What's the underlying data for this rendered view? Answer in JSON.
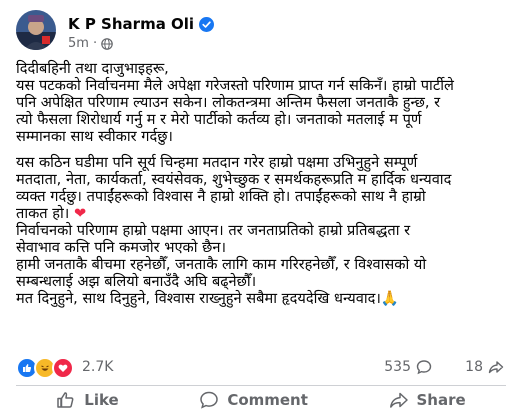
{
  "post": {
    "author": "K P Sharma Oli",
    "time": "5m",
    "separator": "·",
    "paragraph1": [
      "दिदीबहिनी तथा दाजुभाइहरू,",
      "यस पटकको निर्वाचनमा मैले अपेक्षा गरेजस्तो परिणाम प्राप्त गर्न सकिनँ। हाम्रो पार्टीले",
      "पनि अपेक्षित परिणाम ल्याउन सकेन। लोकतन्त्रमा अन्तिम फैसला जनताकै हुन्छ, र",
      "त्यो फैसला शिरोधार्य गर्नु म र मेरो पार्टीको कर्तव्य हो। जनताको मतलाई म पूर्ण",
      "सम्मानका साथ स्वीकार गर्दछु।"
    ],
    "paragraph2": [
      "यस कठिन घडीमा पनि सूर्य चिन्हमा मतदान गरेर हाम्रो पक्षमा उभिनुहुने सम्पूर्ण",
      "मतदाता, नेता, कार्यकर्ता, स्वयंसेवक, शुभेच्छुक र समर्थकहरूप्रति म हार्दिक धन्यवाद",
      "व्यक्त गर्दछु। तपाईंहरूको विश्वास नै हाम्रो शक्ति हो। तपाईंहरूको साथ नै हाम्रो",
      "ताकत हो।",
      "निर्वाचनको परिणाम हाम्रो पक्षमा आएन। तर जनताप्रतिको हाम्रो प्रतिबद्धता र",
      "सेवाभाव कत्ति पनि कमजोर भएको छैन।",
      "हामी जनताकै बीचमा रहनेछौँ, जनताकै लागि काम गरिरहनेछौँ, र विश्वासको यो",
      "सम्बन्धलाई अझ बलियो बनाउँदै अघि बढ्नेछौँ।",
      "मत दिनुहुने, साथ दिनुहुने, विश्वास राख्नुहुने सबैमा हृदयदेखि धन्यवाद।"
    ],
    "heart_emoji": "❤",
    "pray_emoji": "🙏"
  },
  "reactions": {
    "count": "2.7K",
    "comments": "535",
    "shares": "18"
  },
  "actions": {
    "like": "Like",
    "comment": "Comment",
    "share": "Share"
  },
  "colors": {
    "verified": "#1877f2",
    "like_blue": "#1877f2",
    "heart_red": "#f02849",
    "haha_yellow": "#f7b928",
    "muted_text": "#65676b"
  }
}
